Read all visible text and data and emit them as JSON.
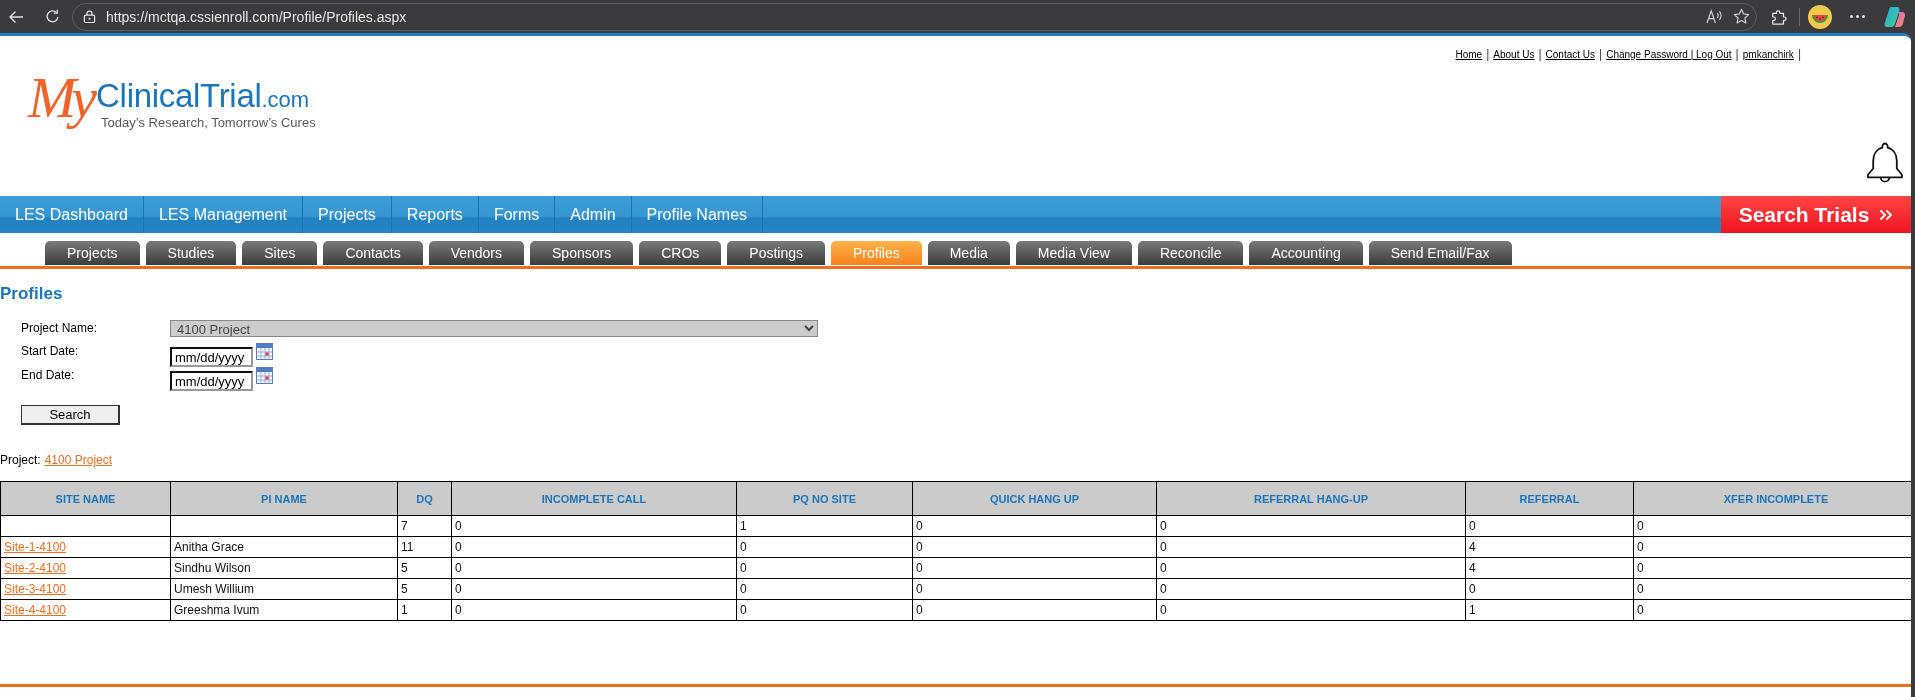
{
  "browser": {
    "url": "https://mctqa.cssienroll.com/Profile/Profiles.aspx"
  },
  "header": {
    "logo": {
      "script": "My",
      "wordmark": "ClinicalTrial",
      "domain": ".com",
      "tagline": "Today’s Research, Tomorrow’s Cures"
    },
    "top_links": [
      {
        "kind": "link",
        "label": "Home"
      },
      {
        "kind": "separator",
        "label": "|"
      },
      {
        "kind": "link",
        "label": "About Us"
      },
      {
        "kind": "separator",
        "label": "|"
      },
      {
        "kind": "link",
        "label": "Contact Us"
      },
      {
        "kind": "separator",
        "label": "|"
      },
      {
        "kind": "link",
        "label": "Change Password | Log Out"
      },
      {
        "kind": "separator",
        "label": "|"
      },
      {
        "kind": "link",
        "label": "pmkanchirk"
      },
      {
        "kind": "separator",
        "label": "|"
      }
    ]
  },
  "main_nav": {
    "items": [
      "LES Dashboard",
      "LES Management",
      "Projects",
      "Reports",
      "Forms",
      "Admin",
      "Profile Names"
    ],
    "search_button": "Search Trials"
  },
  "sub_tabs": [
    {
      "label": "Projects",
      "selected": false
    },
    {
      "label": "Studies",
      "selected": false
    },
    {
      "label": "Sites",
      "selected": false
    },
    {
      "label": "Contacts",
      "selected": false
    },
    {
      "label": "Vendors",
      "selected": false
    },
    {
      "label": "Sponsors",
      "selected": false
    },
    {
      "label": "CROs",
      "selected": false
    },
    {
      "label": "Postings",
      "selected": false
    },
    {
      "label": "Profiles",
      "selected": true
    },
    {
      "label": "Media",
      "selected": false
    },
    {
      "label": "Media View",
      "selected": false
    },
    {
      "label": "Reconcile",
      "selected": false
    },
    {
      "label": "Accounting",
      "selected": false
    },
    {
      "label": "Send Email/Fax",
      "selected": false
    }
  ],
  "page_title": "Profiles",
  "form": {
    "fields": [
      {
        "kind": "select",
        "label": "Project Name:",
        "value": "4100 Project"
      },
      {
        "kind": "date",
        "label": "Start Date:",
        "placeholder": "mm/dd/yyyy"
      },
      {
        "kind": "date",
        "label": "End Date:",
        "placeholder": "mm/dd/yyyy"
      }
    ],
    "submit_button": "Search"
  },
  "project_line": {
    "label": "Project:",
    "link": "4100 Project"
  },
  "table": {
    "columns": [
      {
        "label": "SITE NAME",
        "kind": "link"
      },
      {
        "label": "PI NAME",
        "kind": "text"
      },
      {
        "label": "DQ",
        "kind": "text"
      },
      {
        "label": "INCOMPLETE CALL",
        "kind": "text"
      },
      {
        "label": "PQ NO SITE",
        "kind": "text"
      },
      {
        "label": "QUICK HANG UP",
        "kind": "text"
      },
      {
        "label": "REFERRAL HANG-UP",
        "kind": "text"
      },
      {
        "label": "REFERRAL",
        "kind": "text"
      },
      {
        "label": "XFER INCOMPLETE",
        "kind": "text"
      }
    ],
    "rows": [
      {
        "dq": "7",
        "incomplete_call": "0",
        "pq_no_site": "1",
        "quick_hang_up": "0",
        "referral_hang_up": "0",
        "referral": "0",
        "xfer_incomplete": "0"
      },
      {
        "site_name": "Site-1-4100",
        "pi_name": "Anitha Grace",
        "dq": "11",
        "incomplete_call": "0",
        "pq_no_site": "0",
        "quick_hang_up": "0",
        "referral_hang_up": "0",
        "referral": "4",
        "xfer_incomplete": "0"
      },
      {
        "site_name": "Site-2-4100",
        "pi_name": "Sindhu Wilson",
        "dq": "5",
        "incomplete_call": "0",
        "pq_no_site": "0",
        "quick_hang_up": "0",
        "referral_hang_up": "0",
        "referral": "4",
        "xfer_incomplete": "0"
      },
      {
        "site_name": "Site-3-4100",
        "pi_name": "Umesh Willium",
        "dq": "5",
        "incomplete_call": "0",
        "pq_no_site": "0",
        "quick_hang_up": "0",
        "referral_hang_up": "0",
        "referral": "0",
        "xfer_incomplete": "0"
      },
      {
        "site_name": "Site-4-4100",
        "pi_name": "Greeshma Ivum",
        "dq": "1",
        "incomplete_call": "0",
        "pq_no_site": "0",
        "quick_hang_up": "0",
        "referral_hang_up": "0",
        "referral": "1",
        "xfer_incomplete": "0"
      }
    ]
  }
}
